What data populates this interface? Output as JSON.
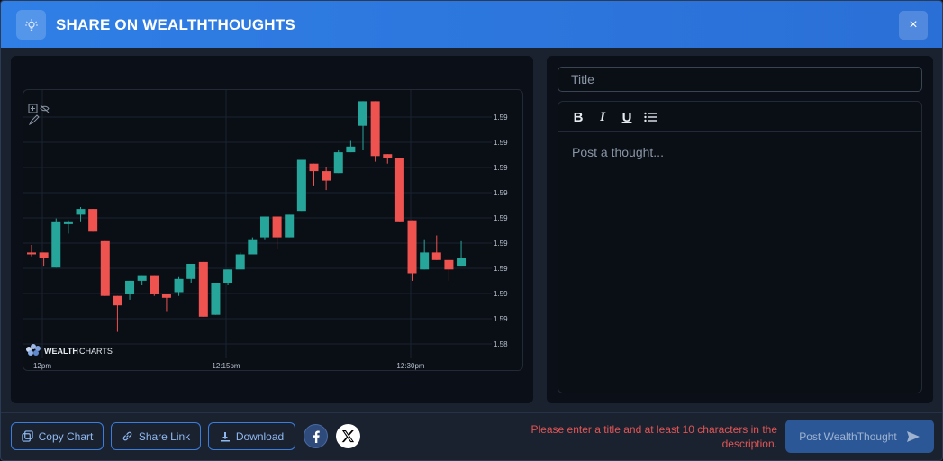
{
  "header": {
    "title": "SHARE ON WEALTHTHOUGHTS",
    "close_label": "×",
    "icon": "lightbulb-icon"
  },
  "chart": {
    "brand": {
      "bold": "WEALTH",
      "light": "CHARTS"
    },
    "y_ticks": [
      "1.59",
      "1.59",
      "1.59",
      "1.59",
      "1.59",
      "1.59",
      "1.59",
      "1.59",
      "1.59",
      "1.58"
    ],
    "x_ticks": [
      "12pm",
      "12:15pm",
      "12:30pm"
    ],
    "colors": {
      "up": "#26a69a",
      "down": "#ef5350",
      "grid": "#1c2430"
    }
  },
  "chart_data": {
    "type": "candlestick",
    "y_tick_labels": [
      "1.59",
      "1.59",
      "1.59",
      "1.59",
      "1.59",
      "1.59",
      "1.59",
      "1.59",
      "1.59",
      "1.58"
    ],
    "x_tick_labels": [
      "12pm",
      "12:15pm",
      "12:30pm"
    ],
    "candles": [
      {
        "o": 5.6,
        "c": 5.5,
        "h": 6.0,
        "l": 5.4
      },
      {
        "o": 5.6,
        "c": 5.3,
        "h": 5.6,
        "l": 4.9
      },
      {
        "o": 4.8,
        "c": 7.2,
        "h": 7.4,
        "l": 4.8
      },
      {
        "o": 7.1,
        "c": 7.2,
        "h": 7.3,
        "l": 6.6
      },
      {
        "o": 7.6,
        "c": 7.9,
        "h": 8.0,
        "l": 7.2
      },
      {
        "o": 7.9,
        "c": 6.7,
        "h": 7.9,
        "l": 6.7
      },
      {
        "o": 6.2,
        "c": 3.3,
        "h": 6.2,
        "l": 3.3
      },
      {
        "o": 3.3,
        "c": 2.8,
        "h": 3.3,
        "l": 1.4
      },
      {
        "o": 3.4,
        "c": 4.1,
        "h": 4.1,
        "l": 3.1
      },
      {
        "o": 4.1,
        "c": 4.4,
        "h": 4.4,
        "l": 3.9
      },
      {
        "o": 4.4,
        "c": 3.4,
        "h": 4.4,
        "l": 3.3
      },
      {
        "o": 3.4,
        "c": 3.2,
        "h": 3.4,
        "l": 2.5
      },
      {
        "o": 3.5,
        "c": 4.2,
        "h": 4.3,
        "l": 3.3
      },
      {
        "o": 4.2,
        "c": 5.0,
        "h": 5.0,
        "l": 4.0
      },
      {
        "o": 5.1,
        "c": 2.2,
        "h": 5.1,
        "l": 2.2
      },
      {
        "o": 2.3,
        "c": 4.0,
        "h": 4.0,
        "l": 2.3
      },
      {
        "o": 4.0,
        "c": 4.7,
        "h": 4.7,
        "l": 3.9
      },
      {
        "o": 4.7,
        "c": 5.5,
        "h": 5.6,
        "l": 4.7
      },
      {
        "o": 5.5,
        "c": 6.3,
        "h": 6.4,
        "l": 5.5
      },
      {
        "o": 6.4,
        "c": 7.5,
        "h": 7.5,
        "l": 6.3
      },
      {
        "o": 7.5,
        "c": 6.4,
        "h": 7.5,
        "l": 5.8
      },
      {
        "o": 6.4,
        "c": 7.6,
        "h": 7.6,
        "l": 6.4
      },
      {
        "o": 7.8,
        "c": 10.5,
        "h": 10.5,
        "l": 7.8
      },
      {
        "o": 10.3,
        "c": 9.9,
        "h": 10.3,
        "l": 9.1
      },
      {
        "o": 9.9,
        "c": 9.4,
        "h": 10.1,
        "l": 8.9
      },
      {
        "o": 9.8,
        "c": 10.9,
        "h": 11.0,
        "l": 9.8
      },
      {
        "o": 10.9,
        "c": 11.2,
        "h": 11.5,
        "l": 10.9
      },
      {
        "o": 12.3,
        "c": 13.6,
        "h": 13.6,
        "l": 11.0
      },
      {
        "o": 13.6,
        "c": 10.7,
        "h": 13.6,
        "l": 10.4
      },
      {
        "o": 10.8,
        "c": 10.6,
        "h": 10.8,
        "l": 10.3
      },
      {
        "o": 10.6,
        "c": 7.2,
        "h": 10.6,
        "l": 7.2
      },
      {
        "o": 7.3,
        "c": 4.5,
        "h": 7.3,
        "l": 4.1
      },
      {
        "o": 4.7,
        "c": 5.6,
        "h": 6.3,
        "l": 4.7
      },
      {
        "o": 5.6,
        "c": 5.2,
        "h": 6.5,
        "l": 5.2
      },
      {
        "o": 5.2,
        "c": 4.7,
        "h": 5.2,
        "l": 4.1
      },
      {
        "o": 4.9,
        "c": 5.3,
        "h": 6.2,
        "l": 4.9
      }
    ]
  },
  "form": {
    "title_placeholder": "Title",
    "title_value": "",
    "editor_placeholder": "Post a thought...",
    "toolbar": {
      "bold": "B",
      "italic": "I",
      "underline": "U",
      "list_icon": "bullet-list-icon"
    }
  },
  "footer": {
    "copy_chart": "Copy Chart",
    "share_link": "Share Link",
    "download": "Download",
    "facebook_icon": "facebook-icon",
    "x_icon": "x-icon",
    "error": "Please enter a title and at least 10 characters in the description.",
    "post_label": "Post WealthThought"
  }
}
